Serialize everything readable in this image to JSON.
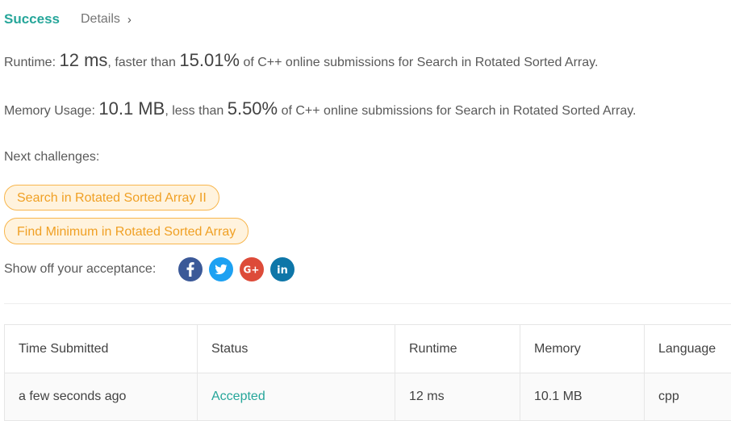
{
  "header": {
    "status_title": "Success",
    "details_label": "Details",
    "details_chevron": "›"
  },
  "runtime": {
    "label": "Runtime:",
    "value": "12 ms",
    "comparison": "faster than",
    "percent": "15.01%",
    "suffix": "of C++ online submissions for Search in Rotated Sorted Array."
  },
  "memory": {
    "label": "Memory Usage:",
    "value": "10.1 MB",
    "comparison": "less than",
    "percent": "5.50%",
    "suffix": "of C++ online submissions for Search in Rotated Sorted Array."
  },
  "next_challenges": {
    "label": "Next challenges:",
    "items": [
      "Search in Rotated Sorted Array II",
      "Find Minimum in Rotated Sorted Array"
    ]
  },
  "share": {
    "label": "Show off your acceptance:",
    "icons": [
      "facebook-icon",
      "twitter-icon",
      "google-plus-icon",
      "linkedin-icon"
    ],
    "colors": {
      "facebook": "#3b5998",
      "twitter": "#1da1f2",
      "google_plus": "#dd4b39",
      "linkedin": "#0e76a8"
    }
  },
  "table": {
    "headers": [
      "Time Submitted",
      "Status",
      "Runtime",
      "Memory",
      "Language"
    ],
    "rows": [
      {
        "time": "a few seconds ago",
        "status": "Accepted",
        "runtime": "12 ms",
        "memory": "10.1 MB",
        "language": "cpp"
      }
    ]
  },
  "colors": {
    "accent_green": "#26a69a",
    "challenge_orange": "#f0a024",
    "challenge_bg": "#fff3de"
  }
}
